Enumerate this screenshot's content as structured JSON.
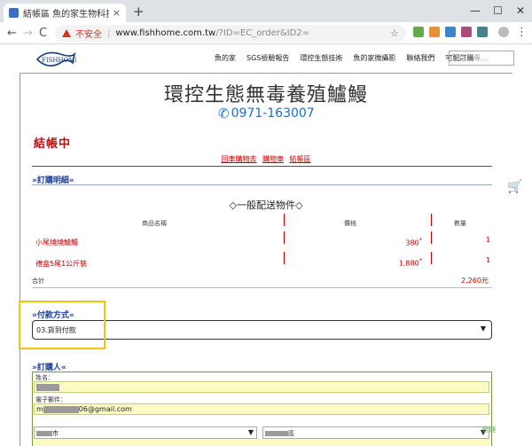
{
  "browser": {
    "tab_title": "結帳區 魚的家生物科技無毒養殖",
    "tab_close": "×",
    "new_tab": "+",
    "window_controls": [
      "—",
      "☐",
      "✕"
    ],
    "nav": {
      "back": "←",
      "forward": "→",
      "reload": "C"
    },
    "security_label": "不安全",
    "url_host": "www.fishhome.com.tw",
    "url_path": "/?ID=EC_order&ID2=",
    "url_sep": "|",
    "omni_icons": [
      "☆"
    ]
  },
  "site": {
    "logo_text": "FISHHOME",
    "menu": [
      "魚的家",
      "SGS檢驗報告",
      "環控生態技術",
      "魚的家微攝影",
      "聯絡我們",
      "宅配訂購"
    ],
    "search_placeholder": "商品搜尋...",
    "title": "環控生態無毒養殖鱸鰻",
    "phone": "0971-163007",
    "phone_icon": "phone-icon"
  },
  "checkout": {
    "heading": "結帳中",
    "breadcrumbs": [
      "回車購物去",
      "購物車",
      "結帳區"
    ],
    "order_section": "»訂購明細«",
    "group_title": "◇一般配送物件◇",
    "columns": [
      "商品名稱",
      "價格",
      "數量"
    ],
    "items": [
      {
        "name": "小尾燒燒鱸鰻",
        "price": "380",
        "qty": "1"
      },
      {
        "name": "禮盒5尾1公斤裝",
        "price": "1,880",
        "qty": "1"
      }
    ],
    "price_mark": "*",
    "total_label": "合計",
    "total_value": "2,260元",
    "payment_section": "»付款方式«",
    "payment_value": "03.貨到付款",
    "buyer_section": "»訂購人«",
    "name_label": "姓名：",
    "email_label": "電子郵件：",
    "email_prefix": "m",
    "email_suffix": "06@gmail.com",
    "city_suffix": "市",
    "district_suffix": "區",
    "select_caret": "▼",
    "watermark": "貞鏈"
  },
  "colors": {
    "accent_red": "#cc0000",
    "link_blue": "#1a3f9e",
    "phone_blue": "#1a6fd1",
    "highlight_yellow": "#f2c311",
    "field_yellow": "#fbfcc4"
  }
}
